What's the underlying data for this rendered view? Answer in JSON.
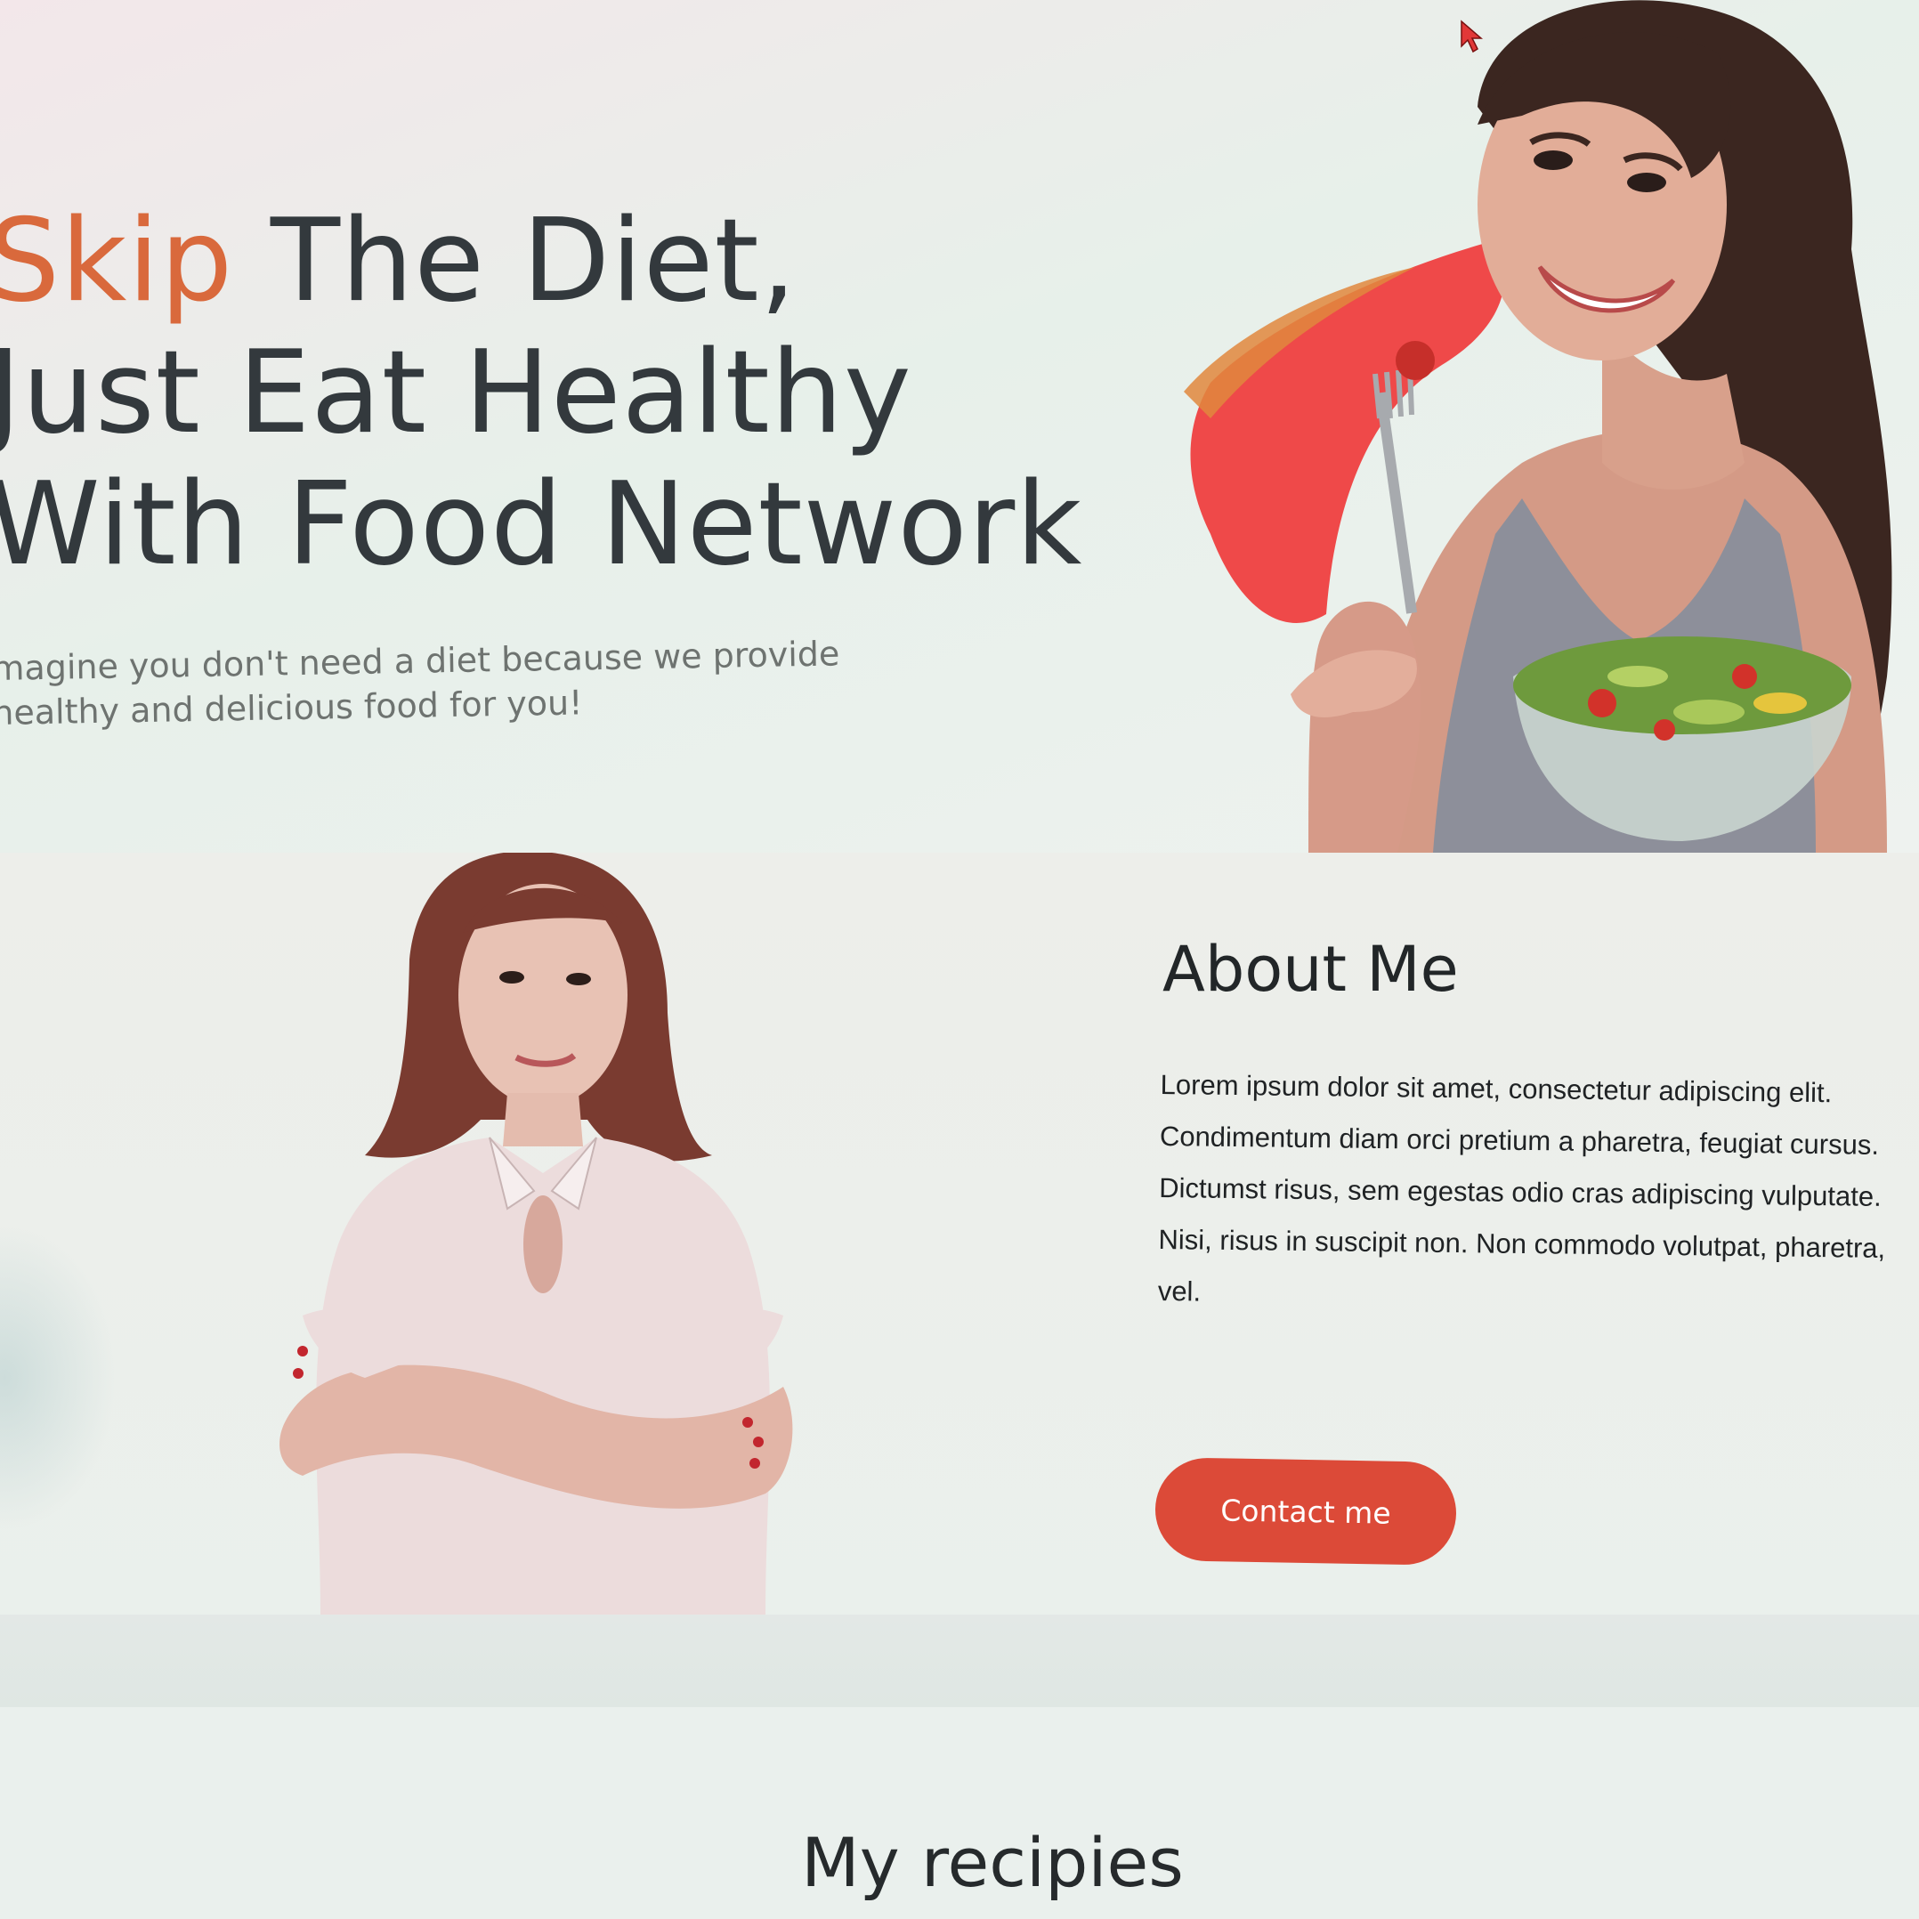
{
  "hero": {
    "title_accent": "Skip",
    "title_rest_line1": " The Diet,",
    "title_line2": "Just Eat Healthy",
    "title_line3": "With Food Network",
    "subtitle": "magine you don't need a diet because we provide healthy and delicious food for you!",
    "accent_color": "#d9693c",
    "image_alt": "Smiling woman holding fork with cherry tomato and a salad bowl"
  },
  "about": {
    "title": "About Me",
    "text": "Lorem ipsum dolor sit amet, consectetur adipiscing elit. Condimentum diam orci pretium a pharetra, feugiat cursus. Dictumst risus, sem egestas odio cras adipiscing vulputate. Nisi, risus in suscipit non. Non commodo volutpat, pharetra, vel.",
    "contact_button_label": "Contact me",
    "button_color": "#dc4a38",
    "image_alt": "Woman with long hair and crossed arms"
  },
  "recipes": {
    "title": "My recipies"
  },
  "icons": {
    "cursor": "mouse-pointer-icon"
  }
}
